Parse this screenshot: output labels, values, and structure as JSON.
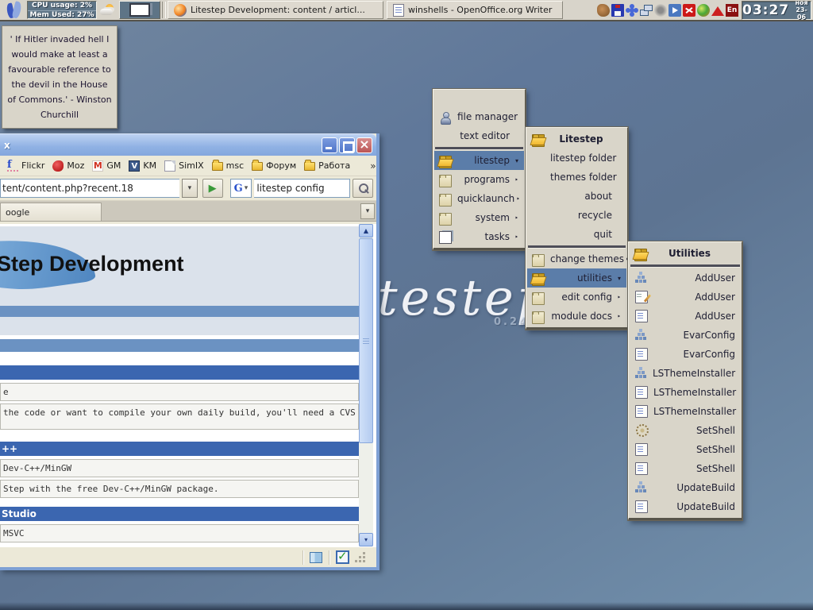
{
  "taskbar": {
    "cpu": {
      "line1": "CPU usage: 2%",
      "line2": "Mem Used: 27%"
    },
    "window_buttons": [
      {
        "label": "Litestep Development: content / articl..."
      },
      {
        "label": "winshells - OpenOffice.org Writer"
      }
    ],
    "tray_language": "En",
    "clock": {
      "time": "03:27",
      "month": "ноя",
      "date": "23-06"
    }
  },
  "sticky_note": {
    "text": "' If Hitler invaded hell I would make at least a favourable reference to the devil in the House of Commons.' - Winston Churchill"
  },
  "chevrons": {
    "overflow": "»",
    "down": "▾",
    "right": "‣",
    "go": "▶",
    "up": "▲"
  },
  "browser": {
    "title_visible": "x",
    "bookmarks_bar": {
      "items": [
        {
          "label": "Flickr"
        },
        {
          "label": "Moz"
        },
        {
          "label": "GM"
        },
        {
          "label": "KM"
        },
        {
          "label": "SimIX"
        },
        {
          "label": "msc"
        },
        {
          "label": "Форум"
        },
        {
          "label": "Работа"
        }
      ],
      "overflow_chevron": "»"
    },
    "address_bar": {
      "url": "tent/content.php?recent.18",
      "search_engine_letter": "G",
      "search_query": "litestep config"
    },
    "tabs": {
      "active_tab_visible": "oogle"
    },
    "page": {
      "heading": "Step Development",
      "sections": [
        {
          "header": "",
          "rows": [
            "e",
            "the code or want to compile your own daily build, you'll need a CVS"
          ]
        },
        {
          "header": "++",
          "rows": [
            "Dev-C++/MinGW",
            "Step with the free Dev-C++/MinGW package."
          ]
        },
        {
          "header": "Studio",
          "rows": [
            "MSVC"
          ]
        }
      ]
    }
  },
  "watermark": {
    "text": "litestep",
    "version": "0.24.7"
  },
  "menus": {
    "main": {
      "items": [
        {
          "label": "file manager",
          "arrow": ""
        },
        {
          "label": "text editor",
          "arrow": ""
        },
        {
          "label": "litestep",
          "arrow": "▾"
        },
        {
          "label": "programs",
          "arrow": "‣"
        },
        {
          "label": "quicklaunch",
          "arrow": "‣"
        },
        {
          "label": "system",
          "arrow": "‣"
        },
        {
          "label": "tasks",
          "arrow": "‣"
        }
      ]
    },
    "litestep": {
      "header": "Litestep",
      "items": [
        {
          "label": "litestep folder",
          "arrow": ""
        },
        {
          "label": "themes folder",
          "arrow": ""
        },
        {
          "label": "about",
          "arrow": ""
        },
        {
          "label": "recycle",
          "arrow": ""
        },
        {
          "label": "quit",
          "arrow": ""
        },
        {
          "label": "change themes",
          "arrow": "‣"
        },
        {
          "label": "utilities",
          "arrow": "▾"
        },
        {
          "label": "edit config",
          "arrow": "‣"
        },
        {
          "label": "module docs",
          "arrow": "‣"
        }
      ]
    },
    "utilities": {
      "header": "Utilities",
      "items": [
        {
          "label": "AddUser"
        },
        {
          "label": "AddUser"
        },
        {
          "label": "AddUser"
        },
        {
          "label": "EvarConfig"
        },
        {
          "label": "EvarConfig"
        },
        {
          "label": "LSThemeInstaller"
        },
        {
          "label": "LSThemeInstaller"
        },
        {
          "label": "LSThemeInstaller"
        },
        {
          "label": "SetShell"
        },
        {
          "label": "SetShell"
        },
        {
          "label": "SetShell"
        },
        {
          "label": "UpdateBuild"
        },
        {
          "label": "UpdateBuild"
        }
      ]
    }
  }
}
